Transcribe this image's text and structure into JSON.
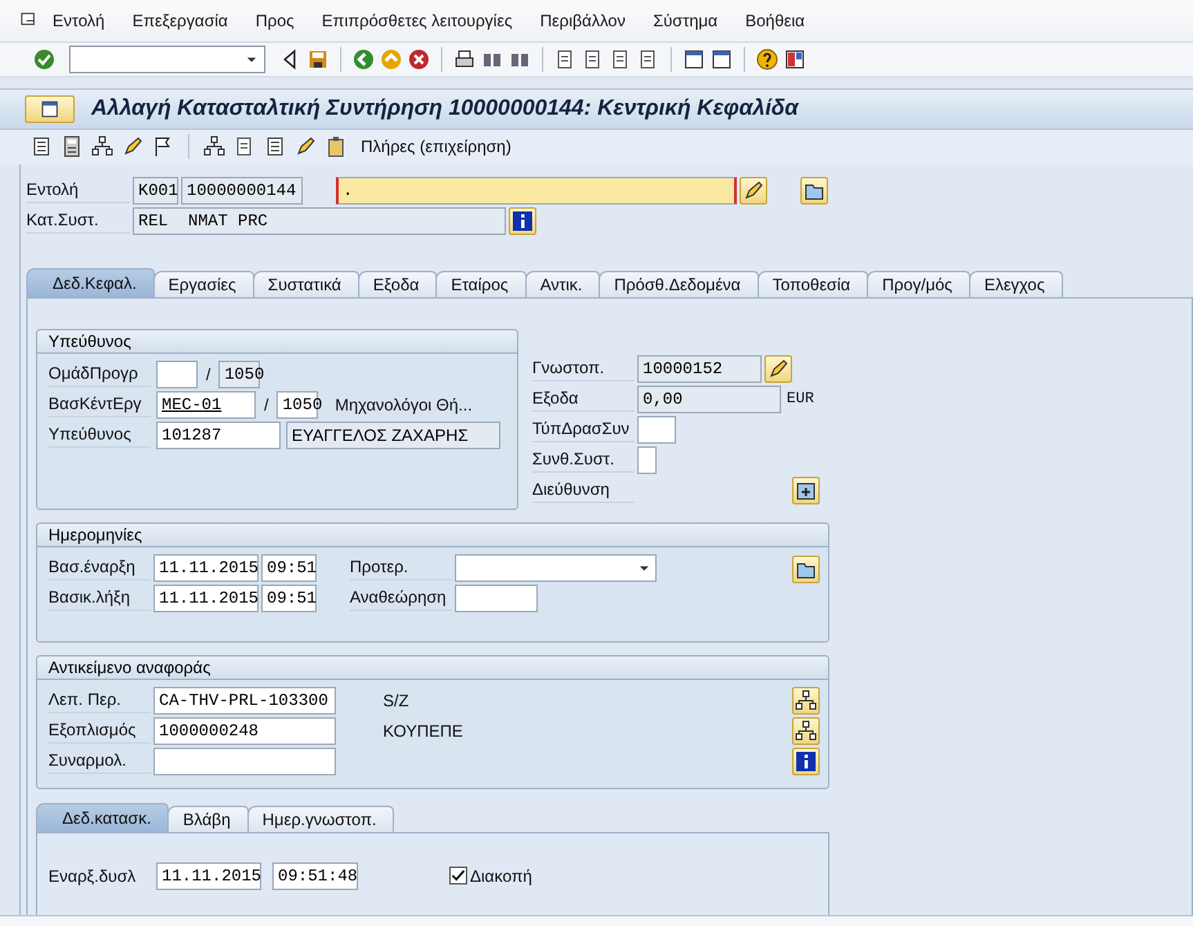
{
  "menu": [
    {
      "label": "Εντολή"
    },
    {
      "label": "Επεξεργασία"
    },
    {
      "label": "Προς"
    },
    {
      "label": "Επιπρόσθετες λειτουργίες"
    },
    {
      "label": "Περιβάλλον"
    },
    {
      "label": "Σύστημα"
    },
    {
      "label": "Βοήθεια"
    }
  ],
  "window": {
    "title": "Αλλαγή Κατασταλτική Συντήρηση 10000000144: Κεντρική Κεφαλίδα"
  },
  "app_toolbar": {
    "label": "Πλήρες (επιχείρηση)"
  },
  "header": {
    "order_label": "Εντολή",
    "order_type": "K001",
    "order_number": "10000000144",
    "description": ".",
    "status_label": "Κατ.Συστ.",
    "status_value": "REL  NMAT PRC"
  },
  "tabs": [
    {
      "label": "Δεδ.Κεφαλ.",
      "selected": true
    },
    {
      "label": "Εργασίες",
      "selected": false
    },
    {
      "label": "Συστατικά",
      "selected": false
    },
    {
      "label": "Εξοδα",
      "selected": false
    },
    {
      "label": "Εταίρος",
      "selected": false
    },
    {
      "label": "Αντικ.",
      "selected": false
    },
    {
      "label": "Πρόσθ.Δεδομένα",
      "selected": false
    },
    {
      "label": "Τοποθεσία",
      "selected": false
    },
    {
      "label": "Προγ/μός",
      "selected": false
    },
    {
      "label": "Ελεγχος",
      "selected": false
    }
  ],
  "responsible": {
    "title": "Υπεύθυνος",
    "rows": [
      {
        "label": "ΟμάδΠρογρ",
        "fields": [
          {
            "kind": "input"
          },
          {
            "kind": "display",
            "value": "1050"
          }
        ],
        "separator": "/"
      },
      {
        "label": "ΒασΚέντΕργ",
        "fields": [
          {
            "kind": "input",
            "value": "MEC-01",
            "link": true
          },
          {
            "kind": "input",
            "value": "1050"
          }
        ],
        "separator": "/",
        "text": "Μηχανολόγοι Θή..."
      },
      {
        "label": "Υπεύθυνος",
        "fields": [
          {
            "kind": "input",
            "value": "101287"
          },
          {
            "kind": "display",
            "value": "ΕΥΑΓΓΕΛΟΣ ΖΑΧΑΡΗΣ"
          }
        ]
      }
    ]
  },
  "notification": {
    "label": "Γνωστοπ.",
    "value": "10000152"
  },
  "costs": {
    "label": "Εξοδα",
    "value": "0,00",
    "currency": "EUR"
  },
  "activity_type": {
    "label": "ΤύπΔρασΣυν"
  },
  "system_condition": {
    "label": "Συνθ.Συστ."
  },
  "address": {
    "label": "Διεύθυνση"
  },
  "dates": {
    "title": "Ημερομηνίες",
    "start_label": "Βασ.έναρξη",
    "start_date": "11.11.2015",
    "start_time": "09:51",
    "end_label": "Βασικ.λήξη",
    "end_date": "11.11.2015",
    "end_time": "09:51",
    "priority_label": "Προτερ.",
    "revision_label": "Αναθεώρηση"
  },
  "reference": {
    "title": "Αντικείμενο αναφοράς",
    "rows": [
      {
        "label": "Λεπ. Περ.",
        "value": "CA-THV-PRL-103300",
        "text": "S/Z"
      },
      {
        "label": "Εξοπλισμός",
        "value": "1000000248",
        "text": "ΚΟΥΠΕΠΕ"
      },
      {
        "label": "Συναρμολ."
      }
    ]
  },
  "subtabs": [
    {
      "label": "Δεδ.κατασκ.",
      "selected": true
    },
    {
      "label": "Βλάβη",
      "selected": false
    },
    {
      "label": "Ημερ.γνωστοπ.",
      "selected": false
    }
  ],
  "malfunction": {
    "label": "Εναρξ.δυσλ",
    "date": "11.11.2015",
    "time": "09:51:48",
    "breakdown_label": "Διακοπή",
    "breakdown_checked": true
  }
}
